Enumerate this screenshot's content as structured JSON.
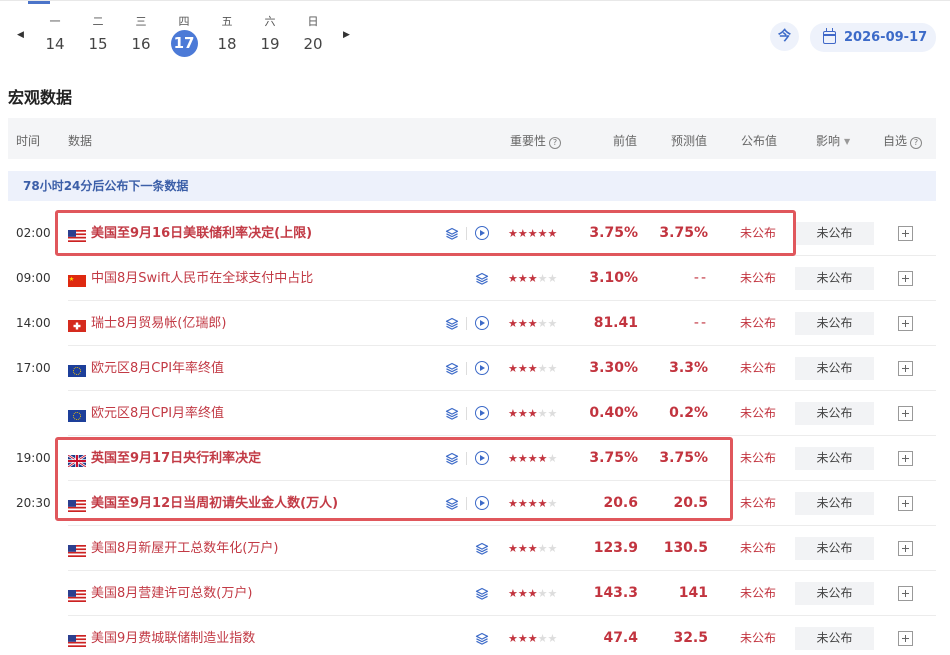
{
  "datebar": {
    "prev_arrow": "◀",
    "next_arrow": "▶",
    "days": [
      {
        "weekday": "一",
        "date": "14"
      },
      {
        "weekday": "二",
        "date": "15"
      },
      {
        "weekday": "三",
        "date": "16"
      },
      {
        "weekday": "四",
        "date": "17"
      },
      {
        "weekday": "五",
        "date": "18"
      },
      {
        "weekday": "六",
        "date": "19"
      },
      {
        "weekday": "日",
        "date": "20"
      }
    ],
    "today_label": "今",
    "selected_date": "2026-09-17"
  },
  "section_title": "宏观数据",
  "table_header": {
    "time": "时间",
    "data": "数据",
    "importance": "重要性",
    "previous": "前值",
    "forecast": "预测值",
    "actual": "公布值",
    "impact": "影响",
    "watch": "自选"
  },
  "notice": "78小时24分后公布下一条数据",
  "rows": [
    {
      "time": "02:00",
      "flag": "us",
      "name": "美国至9月16日美联储利率决定(上限)",
      "bold": true,
      "video": true,
      "stars": 5,
      "previous": "3.75%",
      "forecast": "3.75%",
      "actual": "未公布",
      "impact": "未公布"
    },
    {
      "time": "09:00",
      "flag": "cn",
      "name": "中国8月Swift人民币在全球支付中占比",
      "bold": false,
      "video": false,
      "stars": 3,
      "previous": "3.10%",
      "forecast": "--",
      "actual": "未公布",
      "impact": "未公布"
    },
    {
      "time": "14:00",
      "flag": "ch",
      "name": "瑞士8月贸易帐(亿瑞郎)",
      "bold": false,
      "video": true,
      "stars": 3,
      "previous": "81.41",
      "forecast": "--",
      "actual": "未公布",
      "impact": "未公布"
    },
    {
      "time": "17:00",
      "flag": "eu",
      "name": "欧元区8月CPI年率终值",
      "bold": false,
      "video": true,
      "stars": 3,
      "previous": "3.30%",
      "forecast": "3.3%",
      "actual": "未公布",
      "impact": "未公布"
    },
    {
      "time": "",
      "flag": "eu",
      "name": "欧元区8月CPI月率终值",
      "bold": false,
      "video": true,
      "stars": 3,
      "previous": "0.40%",
      "forecast": "0.2%",
      "actual": "未公布",
      "impact": "未公布"
    },
    {
      "time": "19:00",
      "flag": "uk",
      "name": "英国至9月17日央行利率决定",
      "bold": true,
      "video": true,
      "stars": 4,
      "previous": "3.75%",
      "forecast": "3.75%",
      "actual": "未公布",
      "impact": "未公布"
    },
    {
      "time": "20:30",
      "flag": "us",
      "name": "美国至9月12日当周初请失业金人数(万人)",
      "bold": true,
      "video": true,
      "stars": 4,
      "previous": "20.6",
      "forecast": "20.5",
      "actual": "未公布",
      "impact": "未公布"
    },
    {
      "time": "",
      "flag": "us",
      "name": "美国8月新屋开工总数年化(万户)",
      "bold": false,
      "video": false,
      "stars": 3,
      "previous": "123.9",
      "forecast": "130.5",
      "actual": "未公布",
      "impact": "未公布"
    },
    {
      "time": "",
      "flag": "us",
      "name": "美国8月营建许可总数(万户)",
      "bold": false,
      "video": false,
      "stars": 3,
      "previous": "143.3",
      "forecast": "141",
      "actual": "未公布",
      "impact": "未公布"
    },
    {
      "time": "",
      "flag": "us",
      "name": "美国9月费城联储制造业指数",
      "bold": false,
      "video": false,
      "stars": 3,
      "previous": "47.4",
      "forecast": "32.5",
      "actual": "未公布",
      "impact": "未公布"
    }
  ],
  "colors": {
    "accent": "#4c7ad7",
    "highlight": "#c2343f",
    "annotation_box": "#e0575c"
  }
}
